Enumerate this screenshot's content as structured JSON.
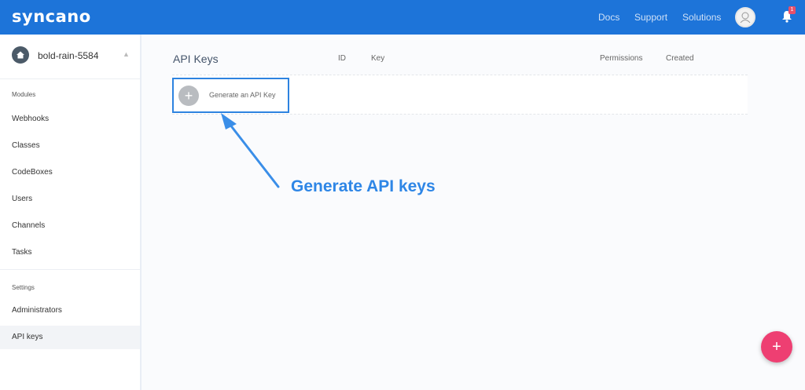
{
  "app": {
    "logo": "syncano"
  },
  "topnav": {
    "docs": "Docs",
    "support": "Support",
    "solutions": "Solutions",
    "notification_count": "1"
  },
  "sidebar": {
    "instance_name": "bold-rain-5584",
    "modules_label": "Modules",
    "modules": [
      "Webhooks",
      "Classes",
      "CodeBoxes",
      "Users",
      "Channels",
      "Tasks"
    ],
    "settings_label": "Settings",
    "settings": [
      "Administrators",
      "API keys"
    ]
  },
  "main": {
    "title": "API Keys",
    "columns": {
      "id": "ID",
      "key": "Key",
      "permissions": "Permissions",
      "created": "Created"
    },
    "generate_button": "Generate an API Key"
  },
  "annotation": {
    "text": "Generate API keys",
    "color": "#2e86e6"
  },
  "colors": {
    "topbar": "#1d74d9",
    "fab": "#ee3f72",
    "highlight": "#2d83e0"
  },
  "icons": [
    "home-icon",
    "caret-icon",
    "avatar-icon",
    "bell-icon",
    "plus-icon"
  ]
}
